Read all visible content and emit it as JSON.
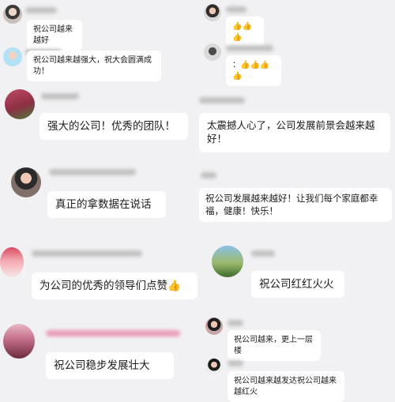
{
  "left_column": {
    "messages": [
      {
        "text": "祝公司越来越好"
      },
      {
        "text": "祝公司越来越强大，祝大会圆满成功！"
      },
      {
        "text": "强大的公司！优秀的团队！"
      },
      {
        "text": "真正的拿数据在说话"
      },
      {
        "text": "为公司的优秀的领导们点赞",
        "emoji": "👍"
      },
      {
        "text": "祝公司稳步发展壮大"
      }
    ]
  },
  "right_column": {
    "messages": [
      {
        "text": "👍👍👍"
      },
      {
        "text": "：👍👍👍👍"
      },
      {
        "text": "太震撼人心了，公司发展前景会越来越好！"
      },
      {
        "text": "祝公司发展越来越好！让我们每个家庭都幸福，健康！快乐！"
      },
      {
        "text": "祝公司红红火火"
      },
      {
        "text": "祝公司越来，更上一层楼"
      },
      {
        "text": "祝公司越来越发达祝公司越来越红火"
      }
    ]
  }
}
